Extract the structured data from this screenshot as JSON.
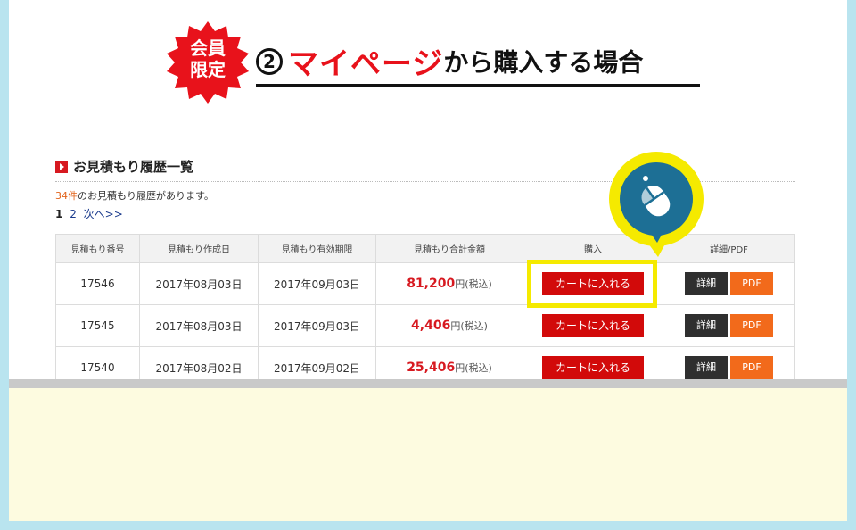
{
  "header": {
    "badge_line1": "会員",
    "badge_line2": "限定",
    "heading_number": "2",
    "heading_highlight": "マイページ",
    "heading_rest": "から購入する場合"
  },
  "section": {
    "title": "お見積もり履歴一覧",
    "count": "34件",
    "count_suffix": "のお見積もり履歴があります。",
    "pager_current": "1",
    "pager_page2": "2",
    "pager_next": "次へ>>"
  },
  "table": {
    "headers": [
      "見積もり番号",
      "見積もり作成日",
      "見積もり有効期限",
      "見積もり合計金額",
      "購入",
      "詳細/PDF"
    ],
    "rows": [
      {
        "id": "17546",
        "created": "2017年08月03日",
        "expires": "2017年09月03日",
        "amount": "81,200",
        "unit": "円(税込)",
        "cart": "カートに入れる",
        "detail": "詳細",
        "pdf": "PDF"
      },
      {
        "id": "17545",
        "created": "2017年08月03日",
        "expires": "2017年09月03日",
        "amount": "4,406",
        "unit": "円(税込)",
        "cart": "カートに入れる",
        "detail": "詳細",
        "pdf": "PDF"
      },
      {
        "id": "17540",
        "created": "2017年08月02日",
        "expires": "2017年09月02日",
        "amount": "25,406",
        "unit": "円(税込)",
        "cart": "カートに入れる",
        "detail": "詳細",
        "pdf": "PDF"
      }
    ]
  },
  "icons": {
    "badge": "burst-badge-icon",
    "pointer": "mouse-click-icon"
  },
  "colors": {
    "accent_red": "#e8121b",
    "highlight_yellow": "#f5ea00",
    "callout_blue": "#1d6f95",
    "pdf_orange": "#f26a1b"
  }
}
